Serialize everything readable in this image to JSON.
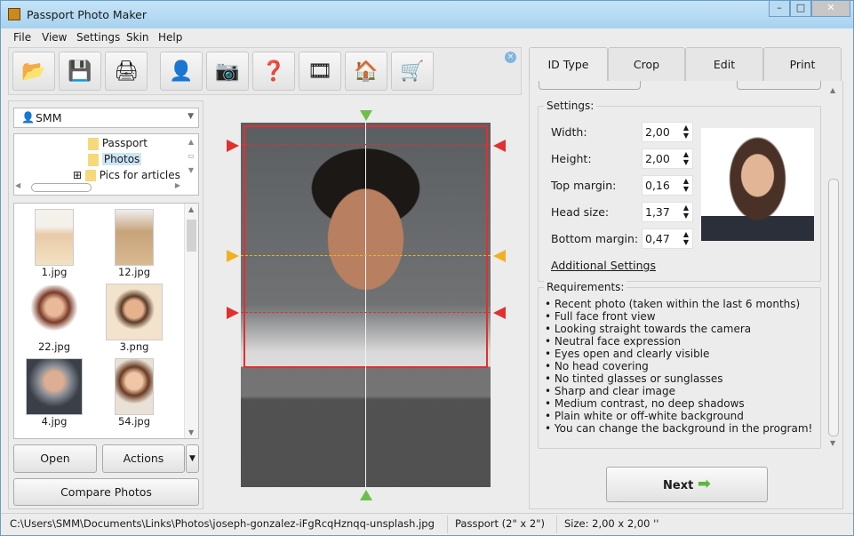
{
  "window": {
    "title": "Passport Photo Maker",
    "controls": [
      "–",
      "□",
      "✕"
    ]
  },
  "menu": [
    "File",
    "View",
    "Settings",
    "Skin",
    "Help"
  ],
  "toolbar": {
    "icons": [
      "open-folder-icon",
      "save-icon",
      "print-icon",
      "user-icon",
      "camera-icon",
      "help-book-icon",
      "film-reel-icon",
      "home-icon",
      "cart-icon"
    ],
    "glyphs": [
      "📂",
      "💾",
      "🖨",
      "👤",
      "📷",
      "❓",
      "🎞",
      "🏠",
      "🛒"
    ]
  },
  "left": {
    "profile": "SMM",
    "tree": [
      "Passport",
      "Photos",
      "Pics for articles"
    ],
    "tree_selected": "Photos",
    "thumbs": [
      "1.jpg",
      "12.jpg",
      "22.jpg",
      "3.png",
      "4.jpg",
      "54.jpg"
    ],
    "open": "Open",
    "actions": "Actions",
    "compare": "Compare Photos"
  },
  "tabs": [
    "ID Type",
    "Crop",
    "Edit",
    "Print"
  ],
  "active_tab": "ID Type",
  "settings": {
    "title": "Settings:",
    "fields": [
      {
        "label": "Width:",
        "value": "2,00"
      },
      {
        "label": "Height:",
        "value": "2,00"
      },
      {
        "label": "Top margin:",
        "value": "0,16"
      },
      {
        "label": "Head size:",
        "value": "1,37"
      },
      {
        "label": "Bottom margin:",
        "value": "0,47"
      }
    ],
    "link": "Additional Settings"
  },
  "requirements": {
    "title": "Requirements:",
    "items": [
      "Recent photo (taken within the last 6 months)",
      "Full face front view",
      "Looking straight towards the camera",
      "Neutral face expression",
      "Eyes open and clearly visible",
      "No head covering",
      "No tinted glasses or sunglasses",
      "Sharp and clear image",
      "Medium contrast, no deep shadows",
      "Plain white or off-white background",
      "You can change the background in the program!"
    ]
  },
  "next": "Next",
  "status": {
    "path": "C:\\Users\\SMM\\Documents\\Links\\Photos\\joseph-gonzalez-iFgRcqHznqq-unsplash.jpg",
    "type": "Passport (2\" x 2\")",
    "size": "Size: 2,00 x 2,00 ''"
  },
  "colors": {
    "crop_line": "#e03030",
    "eye_line": "#f0b020",
    "center_marker": "#6cc04a",
    "titlebar": "#a8d2ef"
  }
}
